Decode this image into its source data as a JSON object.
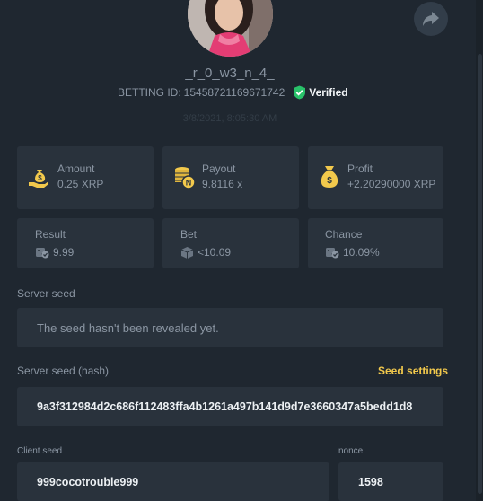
{
  "profile": {
    "username": "_r_0_w3_n_4_",
    "betting_id_label": "BETTING ID:",
    "betting_id": "15458721169671742",
    "verified_label": "Verified",
    "timestamp": "3/8/2021, 8:05:30 AM"
  },
  "stats": {
    "amount": {
      "label": "Amount",
      "value": "0.25 XRP",
      "icon": "money-bag-hand-icon"
    },
    "payout": {
      "label": "Payout",
      "value": "9.8116 x",
      "icon": "coin-stack-icon"
    },
    "profit": {
      "label": "Profit",
      "value": "+2.20290000 XRP",
      "icon": "dollar-bag-icon"
    },
    "result": {
      "label": "Result",
      "value": "9.99",
      "icon": "dice-check-icon"
    },
    "bet": {
      "label": "Bet",
      "value": "<10.09",
      "icon": "cube-icon"
    },
    "chance": {
      "label": "Chance",
      "value": "10.09%",
      "icon": "dice-check-icon"
    }
  },
  "server_seed": {
    "label": "Server seed",
    "value": "The seed hasn't been revealed yet."
  },
  "server_seed_hash": {
    "label": "Server seed (hash)",
    "settings_link": "Seed settings",
    "value": "9a3f312984d2c686f112483ffa4b1261a497b141d9d7e3660347a5bedd1d8"
  },
  "client_seed": {
    "label": "Client seed",
    "value": "999cocotrouble999"
  },
  "nonce": {
    "label": "nonce",
    "value": "1598"
  },
  "colors": {
    "background": "#1f2730",
    "card": "#29323c",
    "accent_gold": "#f2c94c",
    "verified_green": "#29c26a"
  }
}
